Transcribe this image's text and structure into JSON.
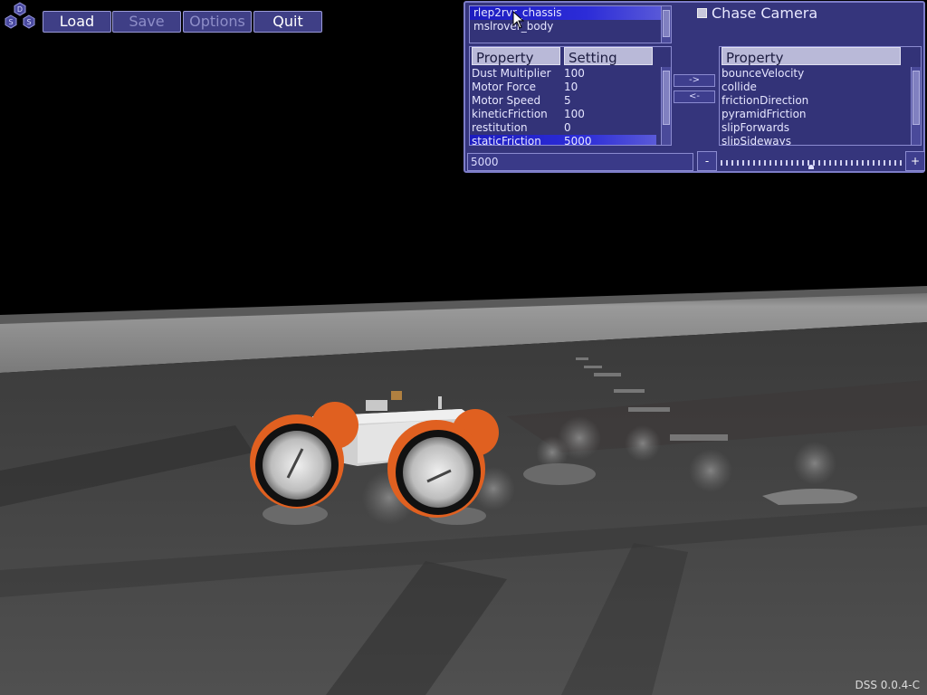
{
  "toolbar": {
    "load": "Load",
    "save": "Save",
    "options": "Options",
    "quit": "Quit"
  },
  "logo": {
    "letters": [
      "D",
      "S",
      "S"
    ]
  },
  "panel": {
    "objects": [
      "rlep2rvr_chassis",
      "mslrover_body"
    ],
    "selected_object": 0,
    "chase_camera_label": "Chase Camera",
    "chase_camera_checked": false,
    "left_table": {
      "headers": [
        "Property",
        "Setting"
      ],
      "rows": [
        {
          "property": "Dust Multiplier",
          "setting": "100"
        },
        {
          "property": "Motor Force",
          "setting": "10"
        },
        {
          "property": "Motor Speed",
          "setting": "5"
        },
        {
          "property": "kineticFriction",
          "setting": "100"
        },
        {
          "property": "restitution",
          "setting": "0"
        },
        {
          "property": "staticFriction",
          "setting": "5000"
        }
      ],
      "selected_row": 5
    },
    "move_right_label": "->",
    "move_left_label": "<-",
    "right_table": {
      "headers": [
        "Property"
      ],
      "rows": [
        "bounceVelocity",
        "collide",
        "frictionDirection",
        "pyramidFriction",
        "slipForwards",
        "slipSideways"
      ]
    },
    "value_input": "5000",
    "minus_label": "-",
    "plus_label": "+",
    "slider_value": 0.5
  },
  "version": "DSS 0.0.4-C",
  "colors": {
    "panel": "#3a3a87",
    "selection": "#2020c8",
    "rover_orange": "#e06020"
  }
}
